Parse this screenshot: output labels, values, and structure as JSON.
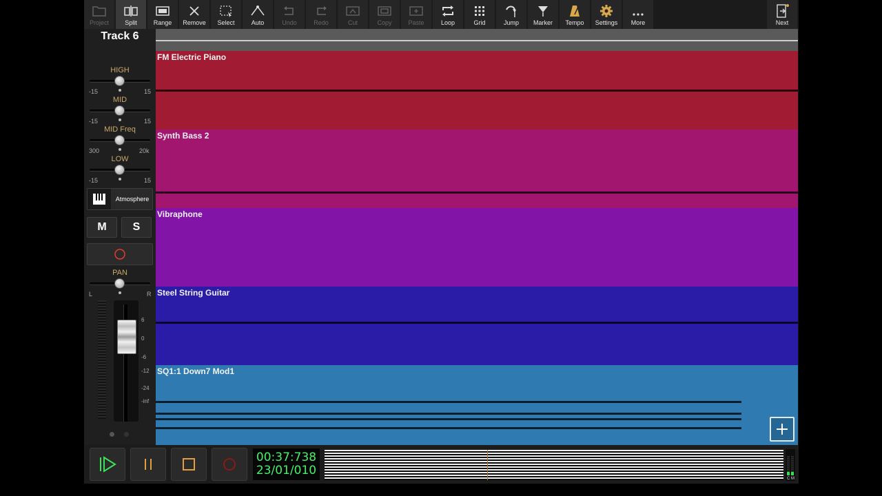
{
  "toolbar": {
    "buttons": [
      {
        "label": "Project",
        "icon": "folder-icon",
        "enabled": false
      },
      {
        "label": "Split",
        "icon": "split-icon",
        "enabled": true
      },
      {
        "label": "Range",
        "icon": "range-icon",
        "enabled": true
      },
      {
        "label": "Remove",
        "icon": "close-icon",
        "enabled": true
      },
      {
        "label": "Select",
        "icon": "select-icon",
        "enabled": true
      },
      {
        "label": "Auto",
        "icon": "automation-icon",
        "enabled": true
      },
      {
        "label": "Undo",
        "icon": "undo-icon",
        "enabled": false
      },
      {
        "label": "Redo",
        "icon": "redo-icon",
        "enabled": false
      },
      {
        "label": "Cut",
        "icon": "cut-icon",
        "enabled": false
      },
      {
        "label": "Copy",
        "icon": "copy-icon",
        "enabled": false
      },
      {
        "label": "Paste",
        "icon": "paste-icon",
        "enabled": false
      },
      {
        "label": "Loop",
        "icon": "loop-icon",
        "enabled": true
      },
      {
        "label": "Grid",
        "icon": "grid-icon",
        "enabled": true
      },
      {
        "label": "Jump",
        "icon": "jump-icon",
        "enabled": true
      },
      {
        "label": "Marker",
        "icon": "marker-icon",
        "enabled": true
      },
      {
        "label": "Tempo",
        "icon": "metronome-icon",
        "enabled": true
      },
      {
        "label": "Settings",
        "icon": "gear-icon",
        "enabled": true
      },
      {
        "label": "More",
        "icon": "more-icon",
        "enabled": true
      }
    ],
    "next_label": "Next"
  },
  "strip": {
    "track_name": "Track 6",
    "eq": [
      {
        "label": "HIGH",
        "min": "-15",
        "max": "15"
      },
      {
        "label": "MID",
        "min": "-15",
        "max": "15"
      },
      {
        "label": "MID Freq",
        "min": "300",
        "max": "20k"
      },
      {
        "label": "LOW",
        "min": "-15",
        "max": "15"
      }
    ],
    "instrument": "Atmosphere",
    "mute_label": "M",
    "solo_label": "S",
    "pan": {
      "label": "PAN",
      "left": "L",
      "right": "R"
    },
    "fader_scale": [
      "6",
      "0",
      "-6",
      "-12",
      "-24",
      "-inf"
    ]
  },
  "tracks": [
    {
      "name": "FM Electric Piano",
      "color": "#a11b32"
    },
    {
      "name": "Synth Bass 2",
      "color": "#a3166f"
    },
    {
      "name": "Vibraphone",
      "color": "#8214a8"
    },
    {
      "name": "Steel String Guitar",
      "color": "#2a1ca6"
    },
    {
      "name": "SQ1:1 Down7 Mod1",
      "color": "#2f7ab0"
    }
  ],
  "transport": {
    "time": "00:37:738",
    "bar_position": "23/01/010",
    "meter_labels": [
      "C",
      "M"
    ]
  }
}
